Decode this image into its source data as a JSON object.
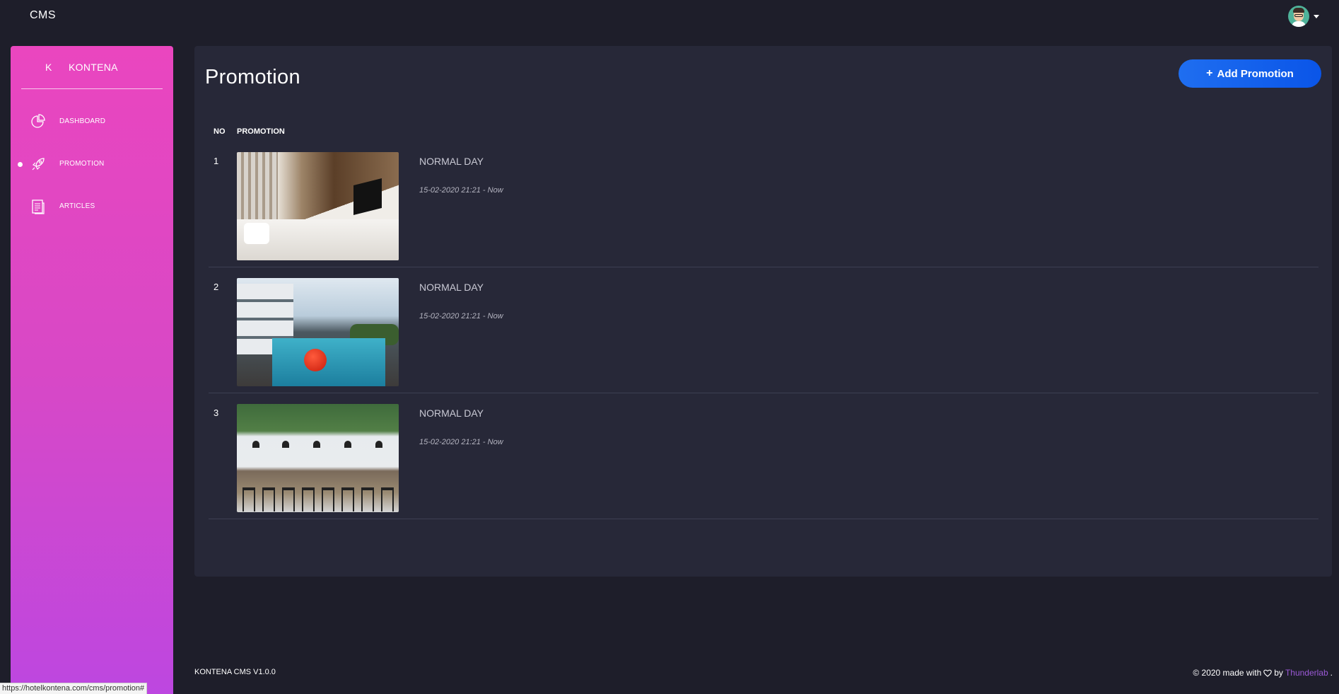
{
  "topbar": {
    "brand": "CMS",
    "user_avatar_icon": "user-avatar-icon",
    "user_menu_icon": "caret-down-icon"
  },
  "sidebar": {
    "logo_mini": "K",
    "logo_text": "KONTENA",
    "items": [
      {
        "label": "DASHBOARD",
        "icon": "pie-chart-icon",
        "active": false
      },
      {
        "label": "PROMOTION",
        "icon": "rocket-icon",
        "active": true
      },
      {
        "label": "ARTICLES",
        "icon": "document-icon",
        "active": false
      }
    ]
  },
  "main": {
    "title": "Promotion",
    "add_button_label": "Add Promotion",
    "add_button_icon": "plus-icon",
    "table": {
      "headers": [
        "NO",
        "PROMOTION"
      ],
      "rows": [
        {
          "no": "1",
          "image": "hotel-room-photo",
          "title": "NORMAL DAY",
          "date": "15-02-2020 21:21 - Now"
        },
        {
          "no": "2",
          "image": "swimming-pool-photo",
          "title": "NORMAL DAY",
          "date": "15-02-2020 21:21 - Now"
        },
        {
          "no": "3",
          "image": "cafe-bar-photo",
          "title": "NORMAL DAY",
          "date": "15-02-2020 21:21 - Now"
        }
      ]
    }
  },
  "footer": {
    "version": "KONTENA CMS V1.0.0",
    "made_with_prefix": "© 2020 made with",
    "by": "by",
    "brand": "Thunderlab",
    "suffix": "."
  },
  "status_bar": {
    "url": "https://hotelkontena.com/cms/promotion#"
  },
  "colors": {
    "background": "#1e1e2a",
    "card": "#272838",
    "sidebar_top": "#ea46bf",
    "sidebar_bottom": "#bd47e0",
    "primary_button": "#1565ec",
    "footer_link": "#9b59d6"
  }
}
